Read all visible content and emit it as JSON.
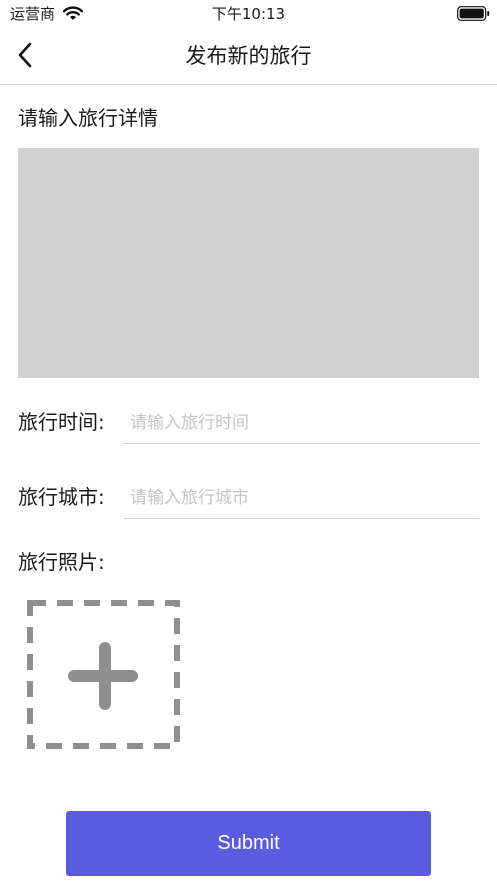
{
  "status_bar": {
    "carrier": "运营商",
    "time": "下午10:13",
    "wifi_icon": "wifi-icon",
    "battery_icon": "battery-icon"
  },
  "nav": {
    "title": "发布新的旅行",
    "back_icon": "chevron-left-icon"
  },
  "form": {
    "details_label": "请输入旅行详情",
    "details_value": "",
    "time_label": "旅行时间:",
    "time_placeholder": "请输入旅行时间",
    "time_value": "",
    "city_label": "旅行城市:",
    "city_placeholder": "请输入旅行城市",
    "city_value": "",
    "photos_label": "旅行照片:",
    "add_photo_icon": "plus-dashed-box-icon",
    "submit_label": "Submit"
  },
  "colors": {
    "accent": "#5b5be2",
    "textarea_bg": "#d1d1d1",
    "placeholder": "#c4c4c4",
    "add_icon": "#8f8f8f"
  }
}
